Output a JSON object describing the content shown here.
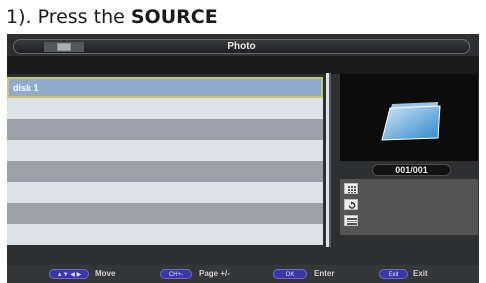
{
  "instruction": {
    "prefix": "1). Press the ",
    "key": "SOURCE"
  },
  "window": {
    "title": "Photo"
  },
  "file_list": {
    "items": [
      {
        "label": "disk 1",
        "selected": true
      },
      {
        "label": ""
      },
      {
        "label": ""
      },
      {
        "label": ""
      },
      {
        "label": ""
      },
      {
        "label": ""
      },
      {
        "label": ""
      },
      {
        "label": ""
      }
    ]
  },
  "preview": {
    "counter": "001/001"
  },
  "info_icons": [
    "grid-icon",
    "rotate-icon",
    "list-icon"
  ],
  "footer": {
    "move": {
      "key": "▲▼ ◀ ▶",
      "label": "Move"
    },
    "page": {
      "key": "CH+-",
      "label": "Page +/-"
    },
    "enter": {
      "key": "OK",
      "label": "Enter"
    },
    "exit": {
      "key": "Exit",
      "label": "Exit"
    }
  },
  "colors": {
    "selected_row": "#8fa9cf",
    "selected_border": "#c8c47a",
    "row_light": "#dde2e6",
    "row_dark": "#9aa1a8",
    "pill": "#3b37a8",
    "panel_bg": "#2e2f30"
  }
}
